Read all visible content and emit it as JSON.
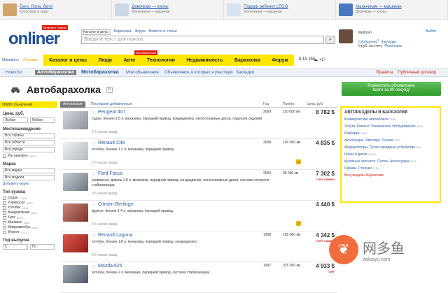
{
  "promos": [
    {
      "title": "Беги, Лола, беги!",
      "sub": "Кроссовки и кеды",
      "color": "#cfa56b"
    },
    {
      "title": "Девочкам — куклы",
      "sub": "Мальчикам — машинки",
      "color": "#ccd7e6"
    },
    {
      "title": "Подари ребенку LEGO",
      "sub": "Мальчикам — машинки",
      "color": "#d9e3f0"
    },
    {
      "title": "Мальчикам — машинки",
      "sub": "Девочкам — куклы",
      "color": "#4a78c0"
    }
  ],
  "header": {
    "logo": "onliner",
    "logo_tag": "Включите Гамать!",
    "search_links": [
      "Каталог и цены",
      "Барахолка",
      "Форум",
      "Новости и статьи"
    ],
    "search_placeholder": "Введите текст для поиска"
  },
  "user": {
    "name": "Molibom",
    "exit": "Выйти",
    "messages": "Сообщения",
    "msg_count": "2",
    "bookmarks": "Закладки",
    "balance": "0 руб. на счету",
    "topup": "Пополнить"
  },
  "nav": {
    "manifest": "Манифест",
    "ads": "Реклама",
    "items": [
      "Каталог и цены",
      "Люди",
      "Авто",
      "Технологии",
      "Недвижимость",
      "Барахолка",
      "Форум"
    ],
    "badge": "Автобарахолка!",
    "rate": "$ 15 255",
    "weather": "+1°"
  },
  "subnav": {
    "news": "Новости",
    "current": "Автобарахолка",
    "moto": "Мотобарахолка",
    "links": [
      "Мои объявления",
      "Объявления, в которых я участвую",
      "Закладки"
    ],
    "rules": "Правила",
    "contract": "Публичный договор"
  },
  "page": {
    "title": "Автобарахолка",
    "add_button_line1": "Разместить объявление",
    "add_button_line2": "всего за 90 секунд!"
  },
  "sidebar": {
    "count": "50689 объявлений",
    "price_label": "Цена, руб.",
    "price_from": "Любая",
    "price_to": "Любая",
    "location_label": "Местонахождение",
    "country": "Все страны",
    "region": "Все области",
    "city": "Все города",
    "customs": "Растаможен",
    "customs_count": "38357",
    "brand_label": "Марка",
    "brand": "Все марки",
    "model": "Все модели",
    "add_brand": "Добавить марку",
    "body_label": "Тип кузова",
    "bodies": [
      {
        "name": "Седан",
        "n": "17436"
      },
      {
        "name": "Универсал",
        "n": "8633"
      },
      {
        "name": "Хэтчбек",
        "n": "4341"
      },
      {
        "name": "Внедорожник",
        "n": "3064"
      },
      {
        "name": "Купе",
        "n": "1005"
      },
      {
        "name": "Минивэн",
        "n": "3063"
      },
      {
        "name": "Микроавтобус",
        "n": "4483"
      },
      {
        "name": "Фургон",
        "n": "1291"
      }
    ],
    "year_label": "Год выпуска",
    "year_from": "С",
    "year_to": "По"
  },
  "tabs": {
    "actual": "Актуальные",
    "recent": "Последние добавленные",
    "year": "Год",
    "mileage": "Пробег",
    "price": "Цена, руб."
  },
  "listings": [
    {
      "model": "Peugeot 407",
      "desc": "седан, бензин 1.8 л, механика, передний привод, кондиционер, легкосплавные диски, подогрев сидений.",
      "meta": "2  6 часов назад",
      "year": "2009",
      "km": "110 000 км",
      "price": "8 782 $",
      "trade": "",
      "num": "",
      "color": "#b9bdc4"
    },
    {
      "model": "Renault Clio",
      "desc": "хетчбэк, бензин 1.2 л, механика, передний привод.",
      "meta": "2  6 часов назад",
      "year": "2008",
      "km": "100 000 км",
      "price": "4 835 $",
      "trade": "",
      "num": "4",
      "color": "#d7d9dc"
    },
    {
      "model": "Ford Focus",
      "desc": "универсал, дизель 1.8 л, механика, передний привод, кондиционер, легкосплавные диски, система контроля стабилизации.",
      "meta": "3  6 часов назад",
      "year": "2004",
      "km": "99 000 км",
      "price": "7 302 $",
      "trade": "ТОРГ ОБМЕН",
      "num": "",
      "color": "#9aa3ad"
    },
    {
      "model": "Citroen Berlingo",
      "desc": "фургон, бензин 1.4 л, механика, передний привод.",
      "meta": "3  6 часов назад",
      "year": "",
      "km": "",
      "price": "4 440 $",
      "trade": "",
      "num": "3",
      "color": "#a35a4a"
    },
    {
      "model": "Renault Laguna",
      "desc": "хетчбэк, бензин 1.8 л, механика, передний привод, кондиционер.",
      "meta": "9  6 часов назад",
      "year": "1998",
      "km": "180 000 км",
      "price": "4 342 $",
      "trade": "ТОРГ ОБМЕН",
      "num": "",
      "color": "#c23a32"
    },
    {
      "model": "Mazda 626",
      "desc": "хетчбэк, бензин 2 л, механика, передний привод, система стабилизации.",
      "meta": "",
      "year": "1997",
      "km": "315 000 км",
      "price": "4 933 $",
      "trade": "ТОРГ",
      "num": "",
      "color": "#6d7785"
    }
  ],
  "right": {
    "title": "АВТОРАЗДЕЛЫ В БАРАХОЛКЕ",
    "items": [
      {
        "name": "Коммерческие автомобили",
        "n": "2845"
      },
      {
        "name": "Услуги. Ремонт. Техническое обслуживание",
        "n": "4418"
      },
      {
        "name": "Разборки",
        "n": "1748"
      },
      {
        "name": "Аксессуары. Автозвук. Тюнинг",
        "n": "8720"
      },
      {
        "name": "Аккумуляторы. Пуско-зарядные устройства",
        "n": "926"
      },
      {
        "name": "Шины и диски",
        "n": "31646"
      },
      {
        "name": "Кузовные запчасти. Салон. Аксессуары",
        "n": "5478"
      },
      {
        "name": "Гаражи. Стоянки",
        "n": "2136"
      }
    ],
    "all": "Все разделы Барахолки"
  },
  "watermark": {
    "cn": "网多鱼",
    "domain": "wduoyu.com"
  }
}
